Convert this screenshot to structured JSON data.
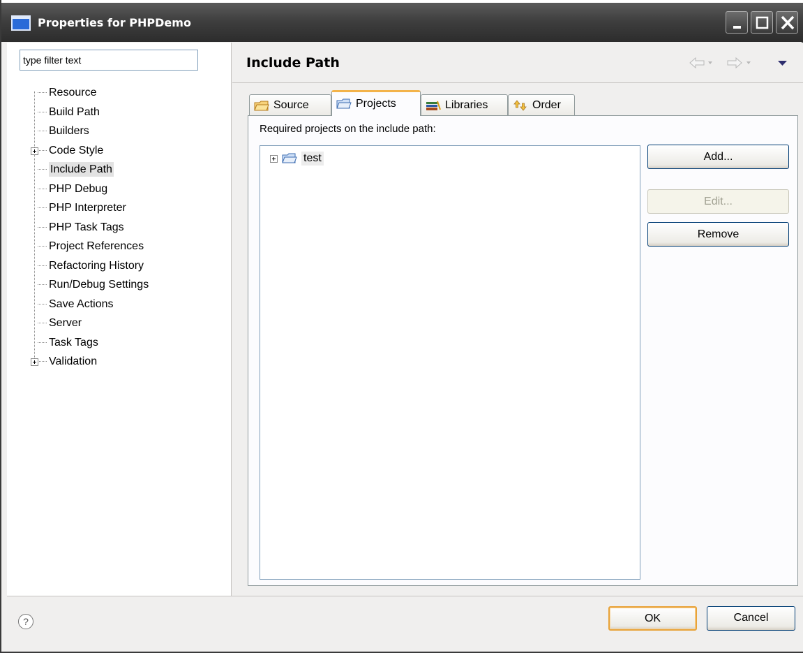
{
  "window": {
    "title": "Properties for PHPDemo"
  },
  "filter": {
    "value": "type filter text"
  },
  "tree": {
    "items": [
      {
        "label": "Resource",
        "expandable": false
      },
      {
        "label": "Build Path",
        "expandable": false
      },
      {
        "label": "Builders",
        "expandable": false
      },
      {
        "label": "Code Style",
        "expandable": true
      },
      {
        "label": "Include Path",
        "expandable": false,
        "selected": true
      },
      {
        "label": "PHP Debug",
        "expandable": false
      },
      {
        "label": "PHP Interpreter",
        "expandable": false
      },
      {
        "label": "PHP Task Tags",
        "expandable": false
      },
      {
        "label": "Project References",
        "expandable": false
      },
      {
        "label": "Refactoring History",
        "expandable": false
      },
      {
        "label": "Run/Debug Settings",
        "expandable": false
      },
      {
        "label": "Save Actions",
        "expandable": false
      },
      {
        "label": "Server",
        "expandable": false
      },
      {
        "label": "Task Tags",
        "expandable": false
      },
      {
        "label": "Validation",
        "expandable": true
      }
    ]
  },
  "page": {
    "title": "Include Path",
    "tabs": [
      {
        "label": "Source",
        "icon": "source-folder-icon"
      },
      {
        "label": "Projects",
        "icon": "open-folder-icon",
        "active": true
      },
      {
        "label": "Libraries",
        "icon": "libraries-icon"
      },
      {
        "label": "Order",
        "icon": "order-icon"
      }
    ],
    "required_label": "Required projects on the include path:",
    "projects": [
      {
        "label": "test"
      }
    ],
    "buttons": {
      "add": "Add...",
      "edit": "Edit...",
      "remove": "Remove"
    }
  },
  "footer": {
    "help": "?",
    "ok": "OK",
    "cancel": "Cancel"
  },
  "colors": {
    "titlebar": "#3f3f3f",
    "ok_border": "#e8a33a",
    "active_tab_accent": "#f3b34a"
  }
}
